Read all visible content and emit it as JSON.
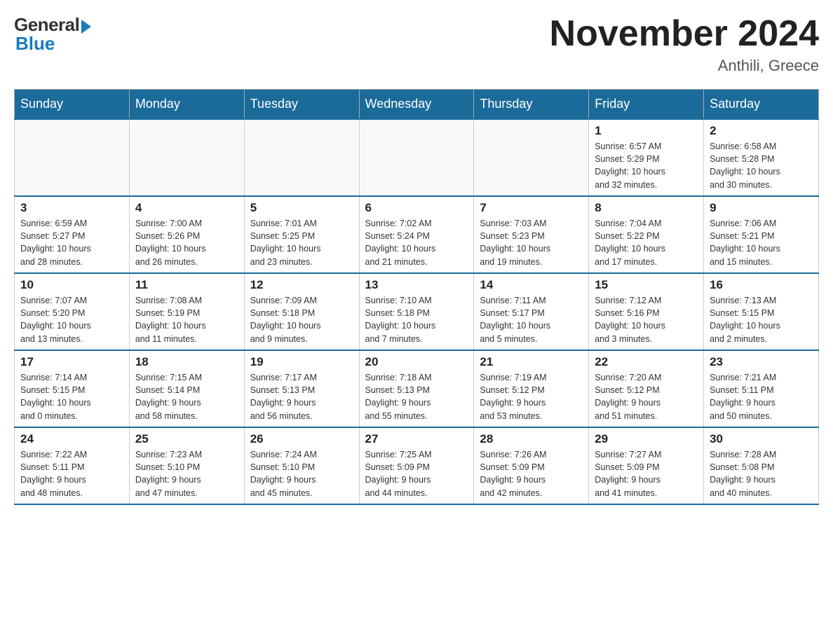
{
  "logo": {
    "general": "General",
    "blue": "Blue"
  },
  "title": "November 2024",
  "subtitle": "Anthili, Greece",
  "days_of_week": [
    "Sunday",
    "Monday",
    "Tuesday",
    "Wednesday",
    "Thursday",
    "Friday",
    "Saturday"
  ],
  "weeks": [
    [
      {
        "day": "",
        "info": ""
      },
      {
        "day": "",
        "info": ""
      },
      {
        "day": "",
        "info": ""
      },
      {
        "day": "",
        "info": ""
      },
      {
        "day": "",
        "info": ""
      },
      {
        "day": "1",
        "info": "Sunrise: 6:57 AM\nSunset: 5:29 PM\nDaylight: 10 hours\nand 32 minutes."
      },
      {
        "day": "2",
        "info": "Sunrise: 6:58 AM\nSunset: 5:28 PM\nDaylight: 10 hours\nand 30 minutes."
      }
    ],
    [
      {
        "day": "3",
        "info": "Sunrise: 6:59 AM\nSunset: 5:27 PM\nDaylight: 10 hours\nand 28 minutes."
      },
      {
        "day": "4",
        "info": "Sunrise: 7:00 AM\nSunset: 5:26 PM\nDaylight: 10 hours\nand 26 minutes."
      },
      {
        "day": "5",
        "info": "Sunrise: 7:01 AM\nSunset: 5:25 PM\nDaylight: 10 hours\nand 23 minutes."
      },
      {
        "day": "6",
        "info": "Sunrise: 7:02 AM\nSunset: 5:24 PM\nDaylight: 10 hours\nand 21 minutes."
      },
      {
        "day": "7",
        "info": "Sunrise: 7:03 AM\nSunset: 5:23 PM\nDaylight: 10 hours\nand 19 minutes."
      },
      {
        "day": "8",
        "info": "Sunrise: 7:04 AM\nSunset: 5:22 PM\nDaylight: 10 hours\nand 17 minutes."
      },
      {
        "day": "9",
        "info": "Sunrise: 7:06 AM\nSunset: 5:21 PM\nDaylight: 10 hours\nand 15 minutes."
      }
    ],
    [
      {
        "day": "10",
        "info": "Sunrise: 7:07 AM\nSunset: 5:20 PM\nDaylight: 10 hours\nand 13 minutes."
      },
      {
        "day": "11",
        "info": "Sunrise: 7:08 AM\nSunset: 5:19 PM\nDaylight: 10 hours\nand 11 minutes."
      },
      {
        "day": "12",
        "info": "Sunrise: 7:09 AM\nSunset: 5:18 PM\nDaylight: 10 hours\nand 9 minutes."
      },
      {
        "day": "13",
        "info": "Sunrise: 7:10 AM\nSunset: 5:18 PM\nDaylight: 10 hours\nand 7 minutes."
      },
      {
        "day": "14",
        "info": "Sunrise: 7:11 AM\nSunset: 5:17 PM\nDaylight: 10 hours\nand 5 minutes."
      },
      {
        "day": "15",
        "info": "Sunrise: 7:12 AM\nSunset: 5:16 PM\nDaylight: 10 hours\nand 3 minutes."
      },
      {
        "day": "16",
        "info": "Sunrise: 7:13 AM\nSunset: 5:15 PM\nDaylight: 10 hours\nand 2 minutes."
      }
    ],
    [
      {
        "day": "17",
        "info": "Sunrise: 7:14 AM\nSunset: 5:15 PM\nDaylight: 10 hours\nand 0 minutes."
      },
      {
        "day": "18",
        "info": "Sunrise: 7:15 AM\nSunset: 5:14 PM\nDaylight: 9 hours\nand 58 minutes."
      },
      {
        "day": "19",
        "info": "Sunrise: 7:17 AM\nSunset: 5:13 PM\nDaylight: 9 hours\nand 56 minutes."
      },
      {
        "day": "20",
        "info": "Sunrise: 7:18 AM\nSunset: 5:13 PM\nDaylight: 9 hours\nand 55 minutes."
      },
      {
        "day": "21",
        "info": "Sunrise: 7:19 AM\nSunset: 5:12 PM\nDaylight: 9 hours\nand 53 minutes."
      },
      {
        "day": "22",
        "info": "Sunrise: 7:20 AM\nSunset: 5:12 PM\nDaylight: 9 hours\nand 51 minutes."
      },
      {
        "day": "23",
        "info": "Sunrise: 7:21 AM\nSunset: 5:11 PM\nDaylight: 9 hours\nand 50 minutes."
      }
    ],
    [
      {
        "day": "24",
        "info": "Sunrise: 7:22 AM\nSunset: 5:11 PM\nDaylight: 9 hours\nand 48 minutes."
      },
      {
        "day": "25",
        "info": "Sunrise: 7:23 AM\nSunset: 5:10 PM\nDaylight: 9 hours\nand 47 minutes."
      },
      {
        "day": "26",
        "info": "Sunrise: 7:24 AM\nSunset: 5:10 PM\nDaylight: 9 hours\nand 45 minutes."
      },
      {
        "day": "27",
        "info": "Sunrise: 7:25 AM\nSunset: 5:09 PM\nDaylight: 9 hours\nand 44 minutes."
      },
      {
        "day": "28",
        "info": "Sunrise: 7:26 AM\nSunset: 5:09 PM\nDaylight: 9 hours\nand 42 minutes."
      },
      {
        "day": "29",
        "info": "Sunrise: 7:27 AM\nSunset: 5:09 PM\nDaylight: 9 hours\nand 41 minutes."
      },
      {
        "day": "30",
        "info": "Sunrise: 7:28 AM\nSunset: 5:08 PM\nDaylight: 9 hours\nand 40 minutes."
      }
    ]
  ]
}
